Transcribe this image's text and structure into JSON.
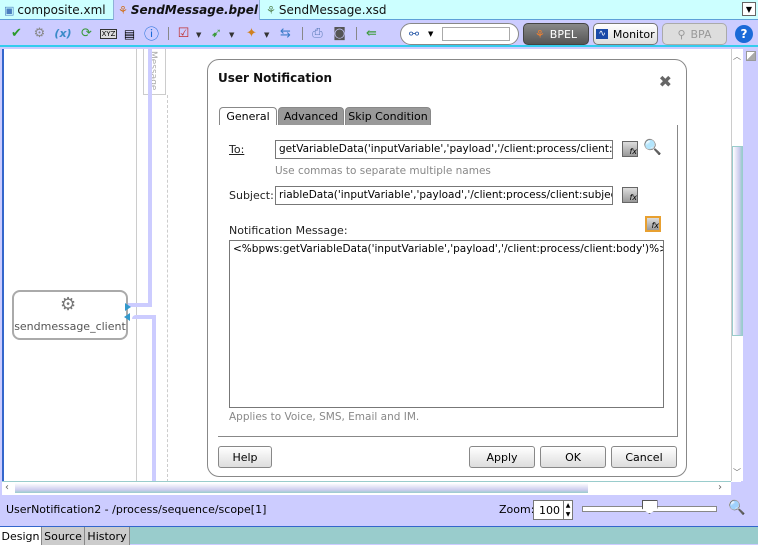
{
  "editor_tabs": [
    {
      "label": "composite.xml",
      "icon": "composite-icon",
      "active": false
    },
    {
      "label": "SendMessage.bpel",
      "icon": "bpel-icon",
      "active": true
    },
    {
      "label": "SendMessage.xsd",
      "icon": "xsd-icon",
      "active": false
    }
  ],
  "toolbar": {
    "icons": [
      "validate-check-icon",
      "settings-gear-icon",
      "variables-icon",
      "refresh-icon",
      "xyz-icon",
      "xslt-icon",
      "info-icon",
      "checklist-icon",
      "activity-icon",
      "deploy-icon",
      "sync-icon",
      "print-icon",
      "camera-icon",
      "link-icon"
    ],
    "search_placeholder": "",
    "mode_buttons": {
      "bpel": "BPEL",
      "monitor": "Monitor",
      "bpa": "BPA"
    }
  },
  "canvas": {
    "partner_link_vertical_label": "Message",
    "partner_node_label": "sendmessage_client"
  },
  "dialog": {
    "title": "User Notification",
    "tabs": [
      "General",
      "Advanced",
      "Skip Condition"
    ],
    "active_tab": "General",
    "to_label": "To:",
    "to_value": "getVariableData('inputVariable','payload','/client:process/client:to')%>",
    "to_hint": "Use commas to separate multiple names",
    "subject_label": "Subject:",
    "subject_value": "riableData('inputVariable','payload','/client:process/client:subject')%>",
    "message_label": "Notification Message:",
    "message_value": "<%bpws:getVariableData('inputVariable','payload','/client:process/client:body')%>",
    "message_hint": "Applies to Voice, SMS, Email and IM.",
    "buttons": {
      "help": "Help",
      "apply": "Apply",
      "ok": "OK",
      "cancel": "Cancel"
    }
  },
  "status": {
    "path": "UserNotification2 - /process/sequence/scope[1]",
    "zoom_label": "Zoom:",
    "zoom_value": "100",
    "zoom_slider_fraction": 0.5
  },
  "bottom_tabs": [
    "Design",
    "Source",
    "History"
  ],
  "active_bottom_tab": "Design"
}
